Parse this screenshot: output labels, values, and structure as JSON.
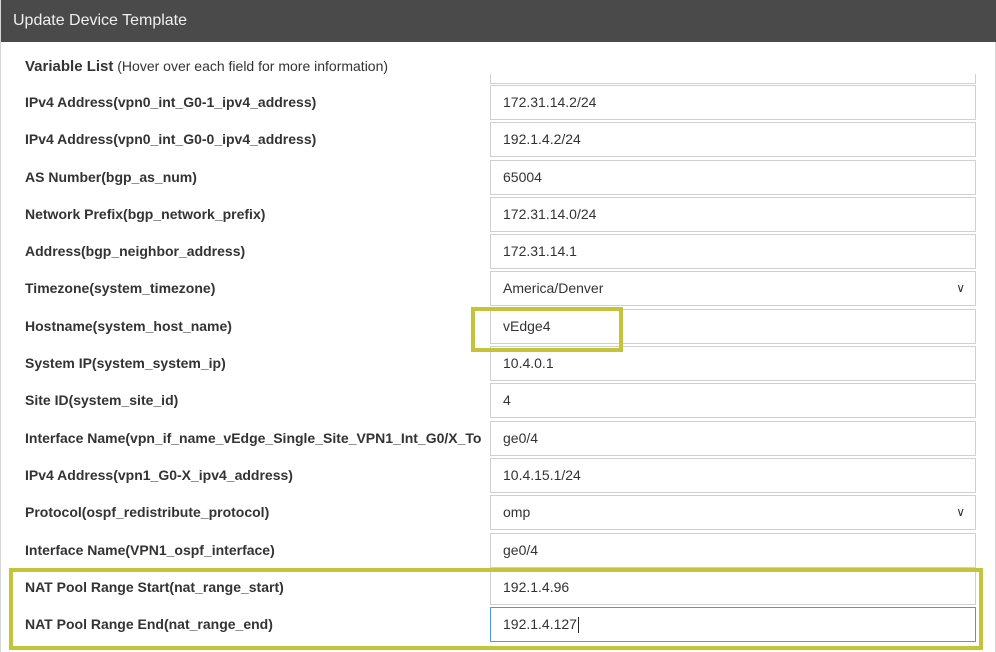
{
  "dialog": {
    "title": "Update Device Template"
  },
  "variable_list": {
    "title": "Variable List",
    "hint": "(Hover over each field for more information)"
  },
  "rows": [
    {
      "label": "IPv4 Address(vpn0_int_G0-1_ipv4_address)",
      "value": "172.31.14.2/24",
      "type": "text"
    },
    {
      "label": "IPv4 Address(vpn0_int_G0-0_ipv4_address)",
      "value": "192.1.4.2/24",
      "type": "text"
    },
    {
      "label": "AS Number(bgp_as_num)",
      "value": "65004",
      "type": "text"
    },
    {
      "label": "Network Prefix(bgp_network_prefix)",
      "value": "172.31.14.0/24",
      "type": "text"
    },
    {
      "label": "Address(bgp_neighbor_address)",
      "value": "172.31.14.1",
      "type": "text"
    },
    {
      "label": "Timezone(system_timezone)",
      "value": "America/Denver",
      "type": "select"
    },
    {
      "label": "Hostname(system_host_name)",
      "value": "vEdge4",
      "type": "text"
    },
    {
      "label": "System IP(system_system_ip)",
      "value": "10.4.0.1",
      "type": "text"
    },
    {
      "label": "Site ID(system_site_id)",
      "value": "4",
      "type": "text"
    },
    {
      "label": "Interface Name(vpn_if_name_vEdge_Single_Site_VPN1_Int_G0/X_To",
      "value": "ge0/4",
      "type": "text"
    },
    {
      "label": "IPv4 Address(vpn1_G0-X_ipv4_address)",
      "value": "10.4.15.1/24",
      "type": "text"
    },
    {
      "label": "Protocol(ospf_redistribute_protocol)",
      "value": "omp",
      "type": "select"
    },
    {
      "label": "Interface Name(VPN1_ospf_interface)",
      "value": "ge0/4",
      "type": "text"
    },
    {
      "label": "NAT Pool Range Start(nat_range_start)",
      "value": "192.1.4.96",
      "type": "text"
    },
    {
      "label": "NAT Pool Range End(nat_range_end)",
      "value": "192.1.4.127",
      "type": "text",
      "active": true
    }
  ],
  "colors": {
    "titlebar": "#4a4a4a",
    "highlight": "#c4c43a",
    "focus": "#4d90fe"
  },
  "icons": {
    "select_chevron": "chevron-down-icon"
  }
}
